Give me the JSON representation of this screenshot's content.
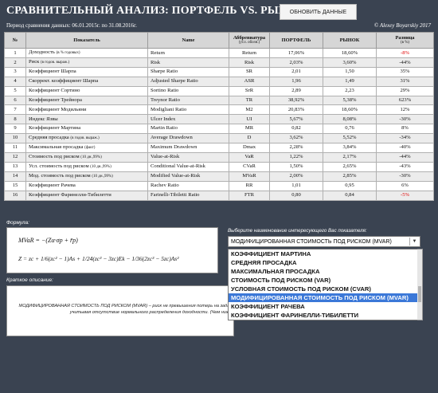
{
  "header": {
    "title": "СРАВНИТЕЛЬНЫЙ АНАЛИЗ: ПОРТФЕЛЬ VS. РЫНОК",
    "update_button": "ОБНОВИТЬ ДАННЫЕ",
    "period": "Период сравнения данных: 06.01.2015г. по 31.08.2016г.",
    "author": "© Alexey Boyarskiy 2017"
  },
  "table": {
    "headers": {
      "num": "№",
      "indicator": "Показатель",
      "name": "Name",
      "abbr": "Аббревиатура",
      "abbr_sub": "(усл. обозн.)",
      "portfolio": "ПОРТФЕЛЬ",
      "market": "РЫНОК",
      "diff": "Разница",
      "diff_sub": "(в %)"
    },
    "rows": [
      {
        "num": "1",
        "ru": "Доходность",
        "ru_sub": "(в % годовых)",
        "en": "Return",
        "abbr": "Return",
        "portfolio": "17,06%",
        "market": "18,60%",
        "diff": "-8%",
        "neg": true
      },
      {
        "num": "2",
        "ru": "Риск",
        "ru_sub": "(в годов. выраж.)",
        "en": "Risk",
        "abbr": "Risk",
        "portfolio": "2,03%",
        "market": "3,60%",
        "diff": "-44%",
        "neg": false
      },
      {
        "num": "3",
        "ru": "Коэффициент Шарпа",
        "ru_sub": "",
        "en": "Sharpe Ratio",
        "abbr": "SR",
        "portfolio": "2,01",
        "market": "1,50",
        "diff": "35%",
        "neg": false
      },
      {
        "num": "4",
        "ru": "Скоррект. коэффициент Шарпа",
        "ru_sub": "",
        "en": "Adjusted Sharpe Ratio",
        "abbr": "ASR",
        "portfolio": "1,96",
        "market": "1,49",
        "diff": "31%",
        "neg": false
      },
      {
        "num": "5",
        "ru": "Коэффициент Сортино",
        "ru_sub": "",
        "en": "Sortino Ratio",
        "abbr": "SrR",
        "portfolio": "2,89",
        "market": "2,23",
        "diff": "29%",
        "neg": false
      },
      {
        "num": "6",
        "ru": "Коэффициент Трейнора",
        "ru_sub": "",
        "en": "Treynor Ratio",
        "abbr": "TR",
        "portfolio": "38,92%",
        "market": "5,38%",
        "diff": "623%",
        "neg": false
      },
      {
        "num": "7",
        "ru": "Коэффициент Модильяни",
        "ru_sub": "",
        "en": "Modigliani Ratio",
        "abbr": "M2",
        "portfolio": "20,83%",
        "market": "18,60%",
        "diff": "12%",
        "neg": false
      },
      {
        "num": "8",
        "ru": "Индекс Язвы",
        "ru_sub": "",
        "en": "Ulcer Index",
        "abbr": "UI",
        "portfolio": "5,67%",
        "market": "8,08%",
        "diff": "-30%",
        "neg": false
      },
      {
        "num": "9",
        "ru": "Коэффициент Мартина",
        "ru_sub": "",
        "en": "Martin Ratio",
        "abbr": "MR",
        "portfolio": "0,82",
        "market": "0,76",
        "diff": "8%",
        "neg": false
      },
      {
        "num": "10",
        "ru": "Средняя просадка",
        "ru_sub": "(в годов. выраж.)",
        "en": "Average Drawdown",
        "abbr": "D",
        "portfolio": "3,62%",
        "market": "5,52%",
        "diff": "-34%",
        "neg": false
      },
      {
        "num": "11",
        "ru": "Максимальная просадка",
        "ru_sub": "(факт)",
        "en": "Maximum Drawdown",
        "abbr": "Dmax",
        "portfolio": "2,28%",
        "market": "3,84%",
        "diff": "-40%",
        "neg": false
      },
      {
        "num": "12",
        "ru": "Стоимость под риском",
        "ru_sub": "(10 дн.,99%)",
        "en": "Value-at-Risk",
        "abbr": "VaR",
        "portfolio": "1,22%",
        "market": "2,17%",
        "diff": "-44%",
        "neg": false
      },
      {
        "num": "13",
        "ru": "Усл. стоимость под риском",
        "ru_sub": "(10 дн.,99%)",
        "en": "Conditional Value-at-Risk",
        "abbr": "CVaR",
        "portfolio": "1,50%",
        "market": "2,65%",
        "diff": "-43%",
        "neg": false
      },
      {
        "num": "14",
        "ru": "Мод. стоимость под риском",
        "ru_sub": "(10 дн.,99%)",
        "en": "Modified Value-at-Risk",
        "abbr": "MVaR",
        "portfolio": "2,00%",
        "market": "2,85%",
        "diff": "-30%",
        "neg": false
      },
      {
        "num": "15",
        "ru": "Коэффициент Рачева",
        "ru_sub": "",
        "en": "Rachev Ratio",
        "abbr": "RR",
        "portfolio": "1,01",
        "market": "0,95",
        "diff": "6%",
        "neg": false
      },
      {
        "num": "16",
        "ru": "Коэффициент Фаринелли-Тибилетти",
        "ru_sub": "",
        "en": "Farinelli-Tibiletti Ratio",
        "abbr": "FTR",
        "portfolio": "0,80",
        "market": "0,84",
        "diff": "-5%",
        "neg": true
      }
    ]
  },
  "formula": {
    "label": "Формула:",
    "line1": "MVaR = −(Zα·σp + r̄p)",
    "line2": "Z = zc + 1/6(zc² − 1)As + 1/24(zc³ − 3zc)Ek − 1/36(2zc³ − 5zc)As²"
  },
  "description": {
    "label": "Краткое описание:",
    "text": "МОДИФИЦИРОВАННАЯ СТОИМОСТЬ ПОД РИСКОМ (MVAR) – риск не превышения потерь на заданном горизонте с определенной вероятностью учитывая отсутствие нормального распределения доходности. (Чем ниже значение, тем лучше)."
  },
  "selector": {
    "label": "Выберите наименование интересующего Вас показателя:",
    "selected": "МОДИФИЦИРОВАННАЯ СТОИМОСТЬ ПОД РИСКОМ (MVAR)",
    "options": [
      "КОЭФФИЦИЕНТ МАРТИНА",
      "СРЕДНЯЯ ПРОСАДКА",
      "МАКСИМАЛЬНАЯ ПРОСАДКА",
      "СТОИМОСТЬ ПОД РИСКОМ (VAR)",
      "УСЛОВНАЯ СТОИМОСТЬ ПОД РИСКОМ (CVAR)",
      "МОДИФИЦИРОВАННАЯ СТОИМОСТЬ ПОД РИСКОМ (MVAR)",
      "КОЭФФИЦИЕНТ РАЧЕВА",
      "КОЭФФИЦИЕНТ ФАРИНЕЛЛИ-ТИБИЛЕТТИ"
    ],
    "selected_index": 5
  },
  "colors": {
    "background": "#3a4351",
    "negative": "#e00000",
    "selection": "#3b78d8"
  }
}
